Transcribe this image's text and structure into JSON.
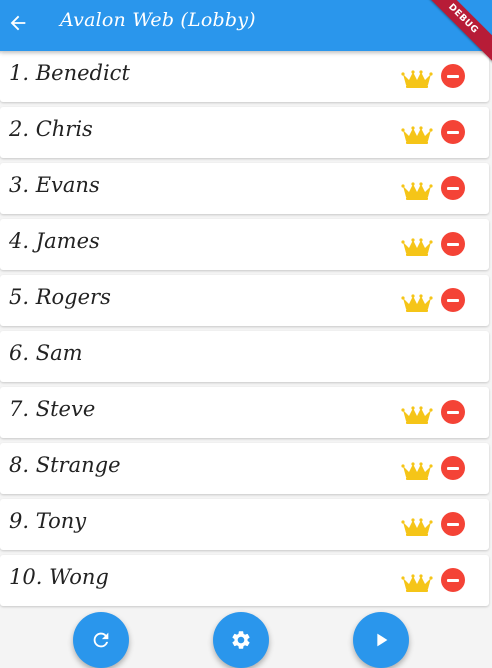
{
  "appbar": {
    "title": "Avalon Web (Lobby)",
    "debug_banner": "DEBUG",
    "back_icon": "arrow-back-icon",
    "color": "#2a96ec"
  },
  "players": [
    {
      "label": "1. Benedict",
      "crown": true,
      "removable": true
    },
    {
      "label": "2. Chris",
      "crown": true,
      "removable": true
    },
    {
      "label": "3. Evans",
      "crown": true,
      "removable": true
    },
    {
      "label": "4. James",
      "crown": true,
      "removable": true
    },
    {
      "label": "5. Rogers",
      "crown": true,
      "removable": true
    },
    {
      "label": "6. Sam",
      "crown": false,
      "removable": false
    },
    {
      "label": "7. Steve",
      "crown": true,
      "removable": true
    },
    {
      "label": "8. Strange",
      "crown": true,
      "removable": true
    },
    {
      "label": "9. Tony",
      "crown": true,
      "removable": true
    },
    {
      "label": "10. Wong",
      "crown": true,
      "removable": true
    }
  ],
  "colors": {
    "crown": "#f5c518",
    "remove": "#f44336"
  },
  "actions": {
    "refresh_icon": "refresh-icon",
    "settings_icon": "settings-icon",
    "play_icon": "play-icon"
  }
}
